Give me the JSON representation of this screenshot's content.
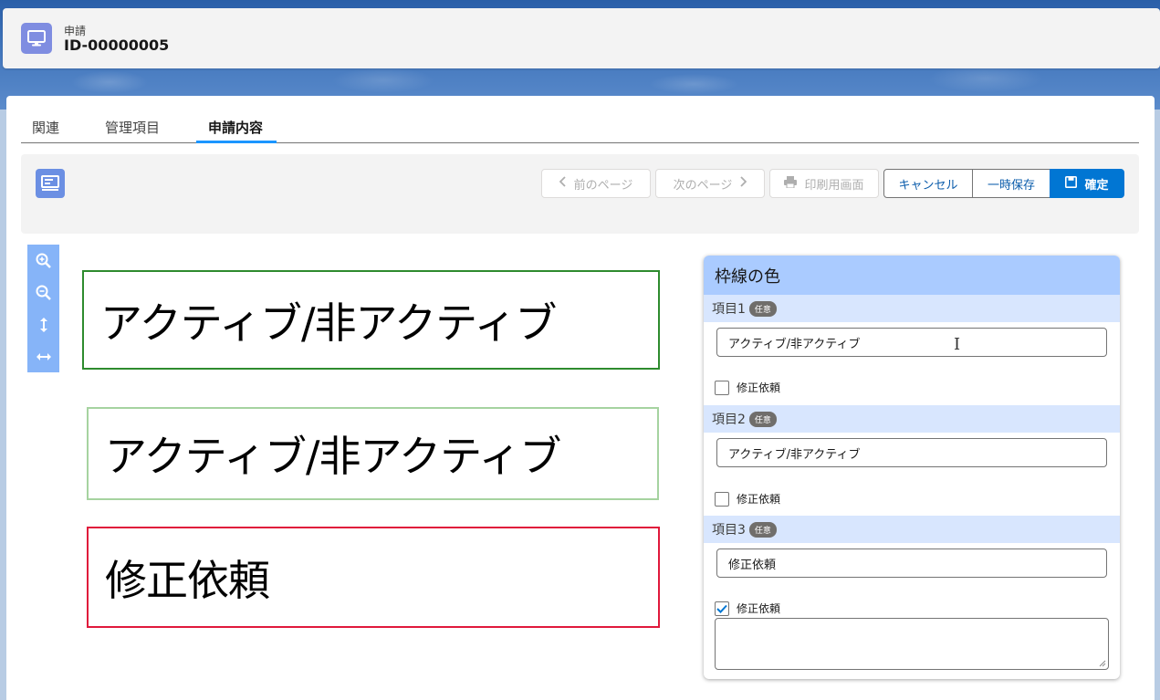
{
  "header": {
    "object_type": "申請",
    "record_name": "ID-00000005"
  },
  "tabs": [
    {
      "label": "関連"
    },
    {
      "label": "管理項目"
    },
    {
      "label": "申請内容"
    }
  ],
  "toolbar": {
    "prev_label": "前のページ",
    "next_label": "次のページ",
    "print_label": "印刷用画面",
    "cancel_label": "キャンセル",
    "save_draft_label": "一時保存",
    "confirm_label": "確定"
  },
  "document": {
    "field1": "アクティブ/非アクティブ",
    "field2": "アクティブ/非アクティブ",
    "field3": "修正依頼"
  },
  "panel": {
    "title": "枠線の色",
    "items": [
      {
        "label": "項目1",
        "badge": "任意",
        "value": "アクティブ/非アクティブ",
        "checkbox_label": "修正依頼",
        "checked": false
      },
      {
        "label": "項目2",
        "badge": "任意",
        "value": "アクティブ/非アクティブ",
        "checkbox_label": "修正依頼",
        "checked": false
      },
      {
        "label": "項目3",
        "badge": "任意",
        "value": "修正依頼",
        "checkbox_label": "修正依頼",
        "checked": true
      }
    ]
  },
  "colors": {
    "box1_border": "#2e8b2e",
    "box2_border": "#a6d3a0",
    "box3_border": "#e0193b",
    "brand": "#0176d3"
  }
}
